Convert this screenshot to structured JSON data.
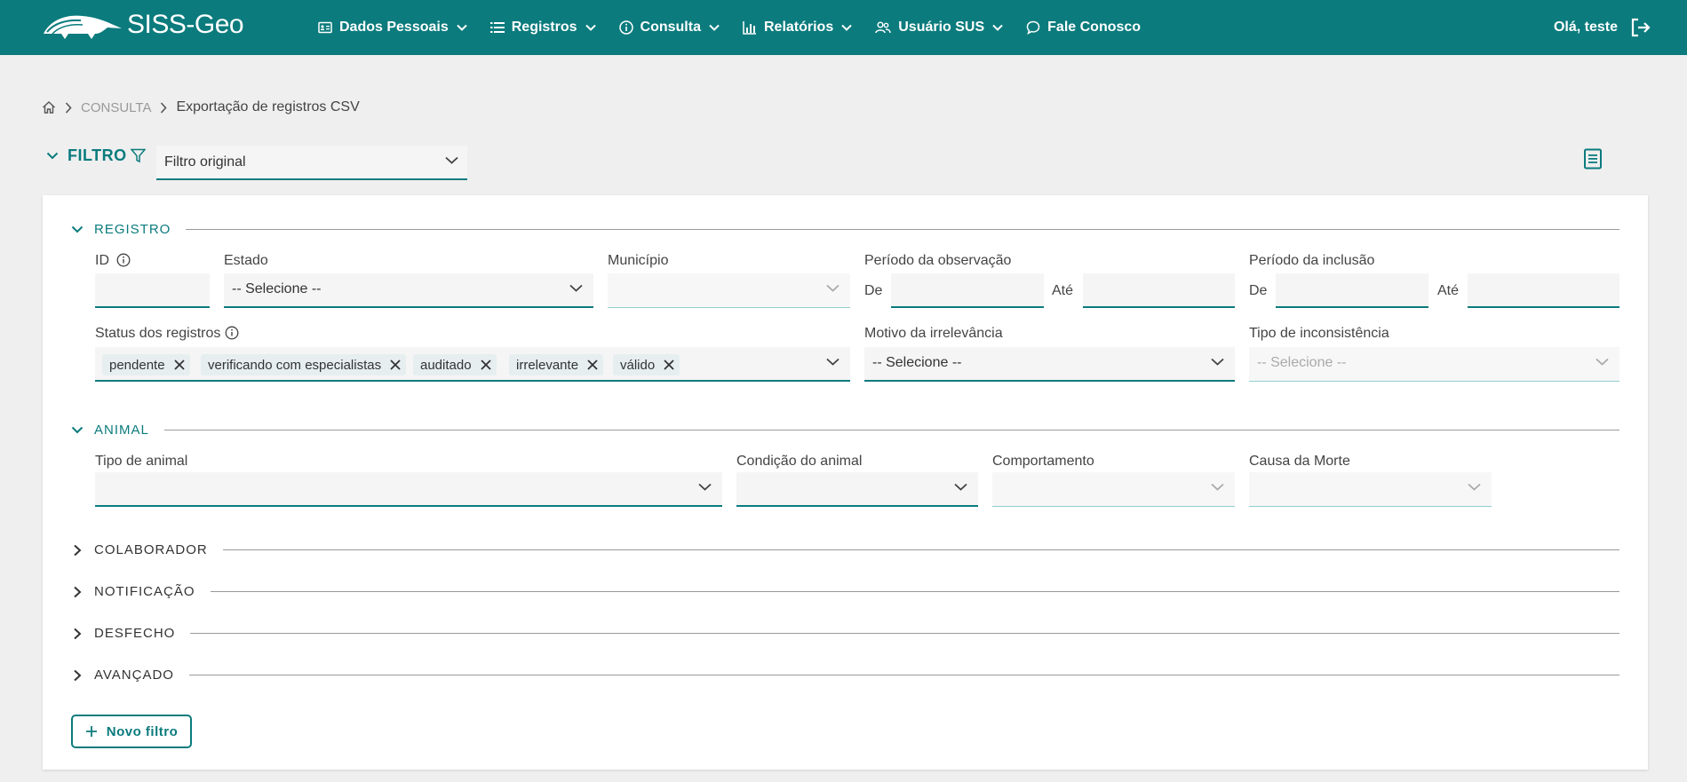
{
  "brand": {
    "name": "SISS-Geo"
  },
  "nav": {
    "items": [
      {
        "label": "Dados Pessoais",
        "icon": "id-card-icon"
      },
      {
        "label": "Registros",
        "icon": "list-icon"
      },
      {
        "label": "Consulta",
        "icon": "info-icon"
      },
      {
        "label": "Relatórios",
        "icon": "bar-chart-icon"
      },
      {
        "label": "Usuário SUS",
        "icon": "users-icon"
      },
      {
        "label": "Fale Conosco",
        "icon": "chat-icon"
      }
    ],
    "greeting": "Olá, teste"
  },
  "breadcrumb": {
    "parent": "CONSULTA",
    "current": "Exportação de registros CSV"
  },
  "filter": {
    "title": "FILTRO",
    "selected": "Filtro original"
  },
  "sections": {
    "registro": "REGISTRO",
    "animal": "ANIMAL",
    "colaborador": "COLABORADOR",
    "notificacao": "NOTIFICAÇÃO",
    "desfecho": "DESFECHO",
    "avancado": "AVANÇADO"
  },
  "registro": {
    "id_label": "ID",
    "estado_label": "Estado",
    "estado_placeholder": "-- Selecione --",
    "municipio_label": "Município",
    "periodo_obs_label": "Período da observação",
    "periodo_inc_label": "Período da inclusão",
    "de": "De",
    "ate": "Até",
    "status_label": "Status dos registros",
    "status_chips": [
      "pendente",
      "verificando com especialistas",
      "auditado",
      "irrelevante",
      "válido"
    ],
    "motivo_label": "Motivo da irrelevância",
    "motivo_placeholder": "-- Selecione --",
    "tipo_inc_label": "Tipo de inconsistência",
    "tipo_inc_placeholder": "-- Selecione --"
  },
  "animal": {
    "tipo_label": "Tipo de animal",
    "condicao_label": "Condição do animal",
    "comportamento_label": "Comportamento",
    "causa_label": "Causa da Morte"
  },
  "actions": {
    "new_filter": "Novo filtro"
  }
}
